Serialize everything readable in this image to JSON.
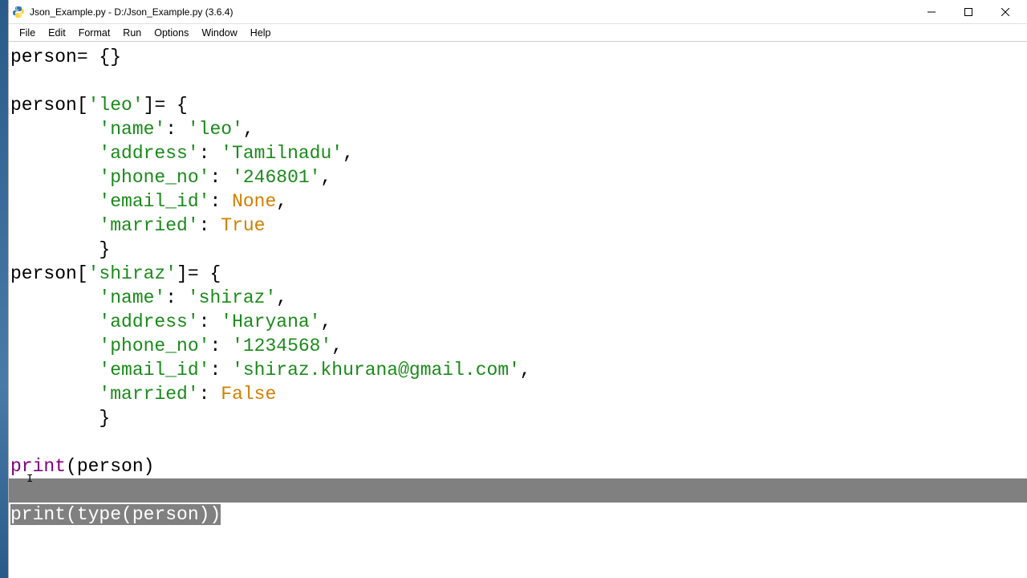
{
  "window": {
    "title": "Json_Example.py - D:/Json_Example.py (3.6.4)"
  },
  "menu": {
    "file": "File",
    "edit": "Edit",
    "format": "Format",
    "run": "Run",
    "options": "Options",
    "window": "Window",
    "help": "Help"
  },
  "code": {
    "l1a": "person= {}",
    "l2": "",
    "l3a": "person[",
    "l3b": "'leo'",
    "l3c": "]= {",
    "l4a": "        ",
    "l4b": "'name'",
    "l4c": ": ",
    "l4d": "'leo'",
    "l4e": ",",
    "l5a": "        ",
    "l5b": "'address'",
    "l5c": ": ",
    "l5d": "'Tamilnadu'",
    "l5e": ",",
    "l6a": "        ",
    "l6b": "'phone_no'",
    "l6c": ": ",
    "l6d": "'246801'",
    "l6e": ",",
    "l7a": "        ",
    "l7b": "'email_id'",
    "l7c": ": ",
    "l7d": "None",
    "l7e": ",",
    "l8a": "        ",
    "l8b": "'married'",
    "l8c": ": ",
    "l8d": "True",
    "l9a": "        }",
    "l10a": "person[",
    "l10b": "'shiraz'",
    "l10c": "]= {",
    "l11a": "        ",
    "l11b": "'name'",
    "l11c": ": ",
    "l11d": "'shiraz'",
    "l11e": ",",
    "l12a": "        ",
    "l12b": "'address'",
    "l12c": ": ",
    "l12d": "'Haryana'",
    "l12e": ",",
    "l13a": "        ",
    "l13b": "'phone_no'",
    "l13c": ": ",
    "l13d": "'1234568'",
    "l13e": ",",
    "l14a": "        ",
    "l14b": "'email_id'",
    "l14c": ": ",
    "l14d": "'shiraz.khurana@gmail.com'",
    "l14e": ",",
    "l15a": "        ",
    "l15b": "'married'",
    "l15c": ": ",
    "l15d": "False",
    "l16a": "        }",
    "l17": "",
    "l18a": "print",
    "l18b": "(person)",
    "l19": "",
    "l20a": "print",
    "l20b": "(",
    "l20c": "type",
    "l20d": "(person))"
  }
}
